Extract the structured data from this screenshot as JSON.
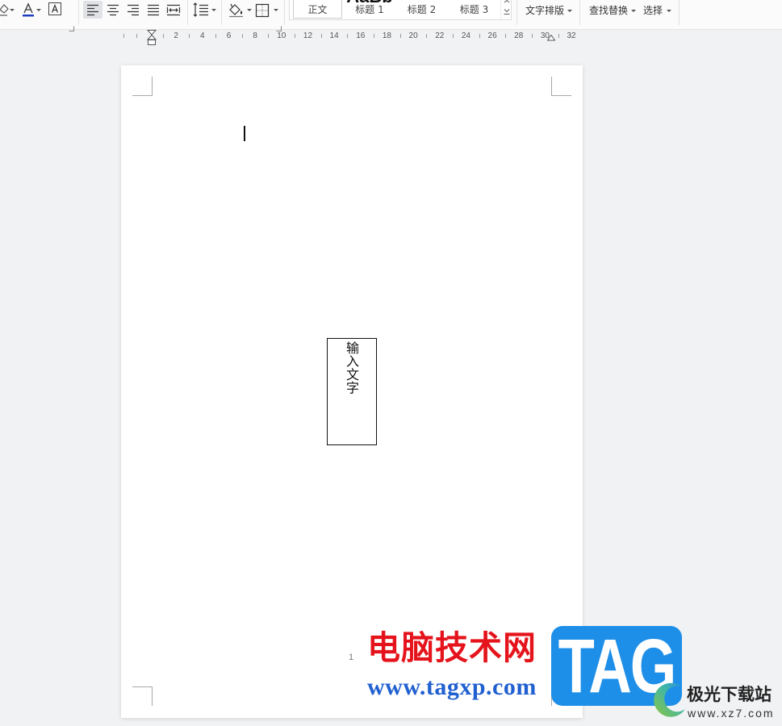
{
  "toolbar": {
    "icons": [
      "highlight-icon",
      "font-color-icon",
      "character-border-icon",
      "align-left-icon",
      "align-center-icon",
      "align-right-icon",
      "justify-icon",
      "distributed-icon",
      "line-spacing-icon",
      "shading-icon",
      "borders-icon"
    ],
    "active_alignment_icon": "align-left-icon",
    "font_color": "#1f3fbf",
    "styles": {
      "preview": "AaBb",
      "items": [
        {
          "label": "正文",
          "selected": true
        },
        {
          "label": "标题 1",
          "selected": false
        },
        {
          "label": "标题 2",
          "selected": false
        },
        {
          "label": "标题 3",
          "selected": false
        }
      ]
    },
    "text_layout_label": "文字排版",
    "find_replace_label": "查找替换",
    "select_label": "选择"
  },
  "ruler": {
    "labels": [
      2,
      4,
      6,
      8,
      10,
      12,
      14,
      16,
      18,
      20,
      22,
      24,
      26,
      28,
      30,
      32
    ]
  },
  "document": {
    "textbox_text": "输入文字",
    "vertical_text": true,
    "page_number": "1"
  },
  "watermark": {
    "site_name": "电脑技术网",
    "site_url": "www.tagxp.com",
    "logo_text": "TAG",
    "brand_name": "极光下载站",
    "brand_url": "www.xz7.com"
  },
  "colors": {
    "workspace_bg": "#f1f2f4",
    "selected_alignment_bg": "#e0e2e6",
    "watermark_red": "#e5141c",
    "watermark_blue": "#2060d0",
    "logo_blue": "#1e8fe8"
  }
}
